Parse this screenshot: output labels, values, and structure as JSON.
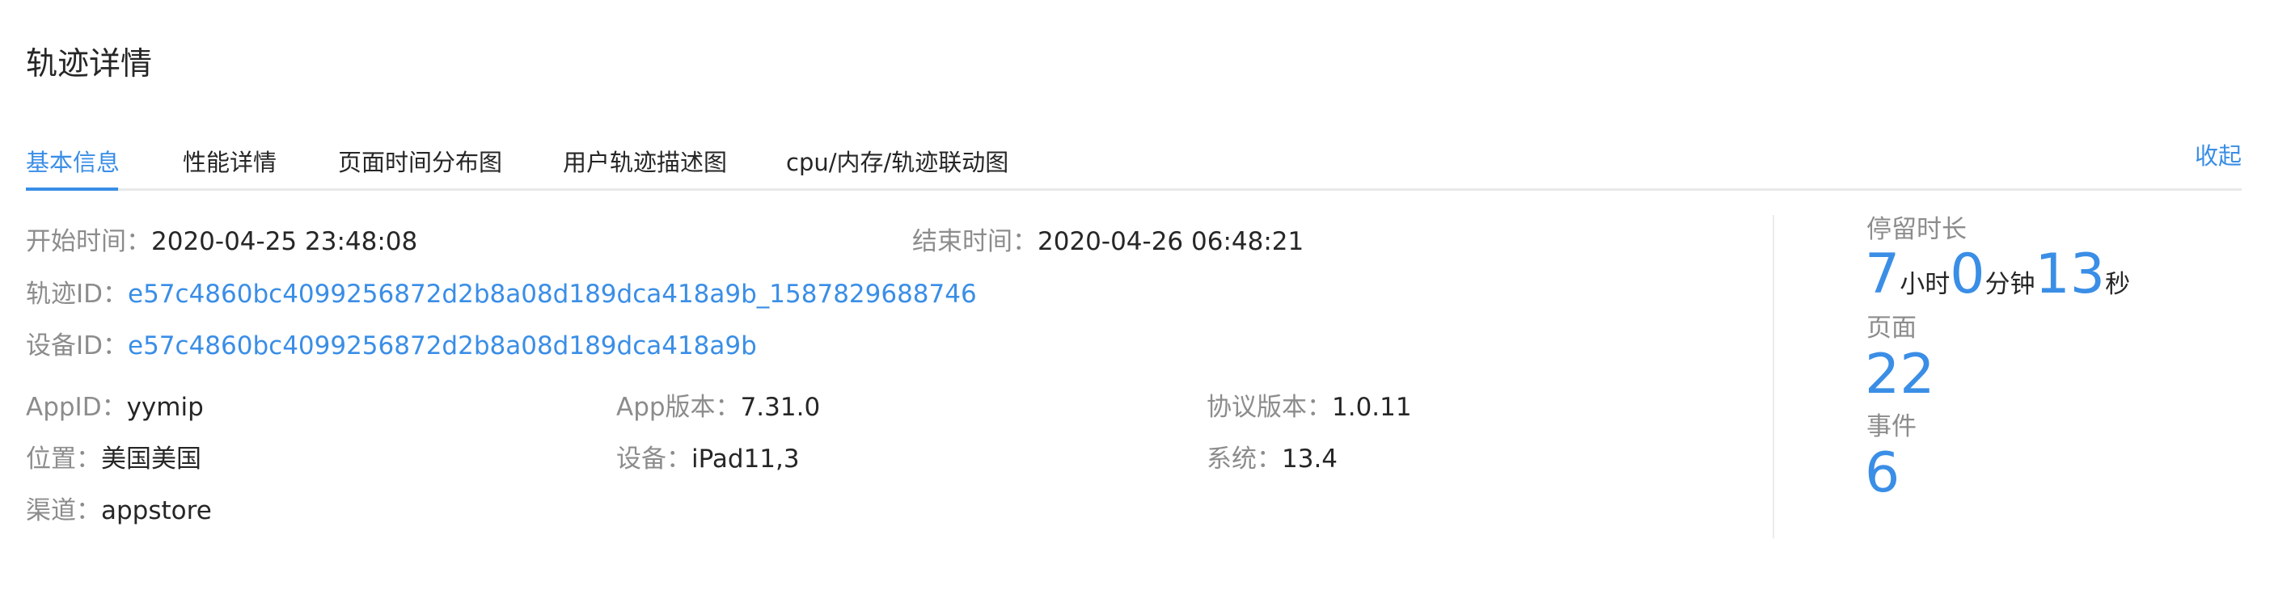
{
  "page": {
    "title": "轨迹详情"
  },
  "tabs": [
    {
      "label": "基本信息",
      "active": true
    },
    {
      "label": "性能详情",
      "active": false
    },
    {
      "label": "页面时间分布图",
      "active": false
    },
    {
      "label": "用户轨迹描述图",
      "active": false
    },
    {
      "label": "cpu/内存/轨迹联动图",
      "active": false
    }
  ],
  "collapse_label": "收起",
  "info": {
    "start_label": "开始时间：",
    "start_value": "2020-04-25 23:48:08",
    "end_label": "结束时间：",
    "end_value": "2020-04-26 06:48:21",
    "track_id_label": "轨迹ID：",
    "track_id_value": "e57c4860bc4099256872d2b8a08d189dca418a9b_1587829688746",
    "device_id_label": "设备ID：",
    "device_id_value": "e57c4860bc4099256872d2b8a08d189dca418a9b",
    "appid_label": "AppID：",
    "appid_value": "yymip",
    "app_version_label": "App版本：",
    "app_version_value": "7.31.0",
    "protocol_label": "协议版本：",
    "protocol_value": "1.0.11",
    "location_label": "位置：",
    "location_value": "美国美国",
    "device_label": "设备：",
    "device_value": "iPad11,3",
    "system_label": "系统：",
    "system_value": "13.4",
    "channel_label": "渠道：",
    "channel_value": "appstore"
  },
  "stats": {
    "duration_label": "停留时长",
    "hours": "7",
    "hours_unit": "小时",
    "minutes": "0",
    "minutes_unit": "分钟",
    "seconds": "13",
    "seconds_unit": "秒",
    "pages_label": "页面",
    "pages_value": "22",
    "events_label": "事件",
    "events_value": "6"
  },
  "colors": {
    "accent": "#3a8ee6",
    "label": "#8c8c8c",
    "text": "#262626",
    "divider": "#ececec"
  }
}
